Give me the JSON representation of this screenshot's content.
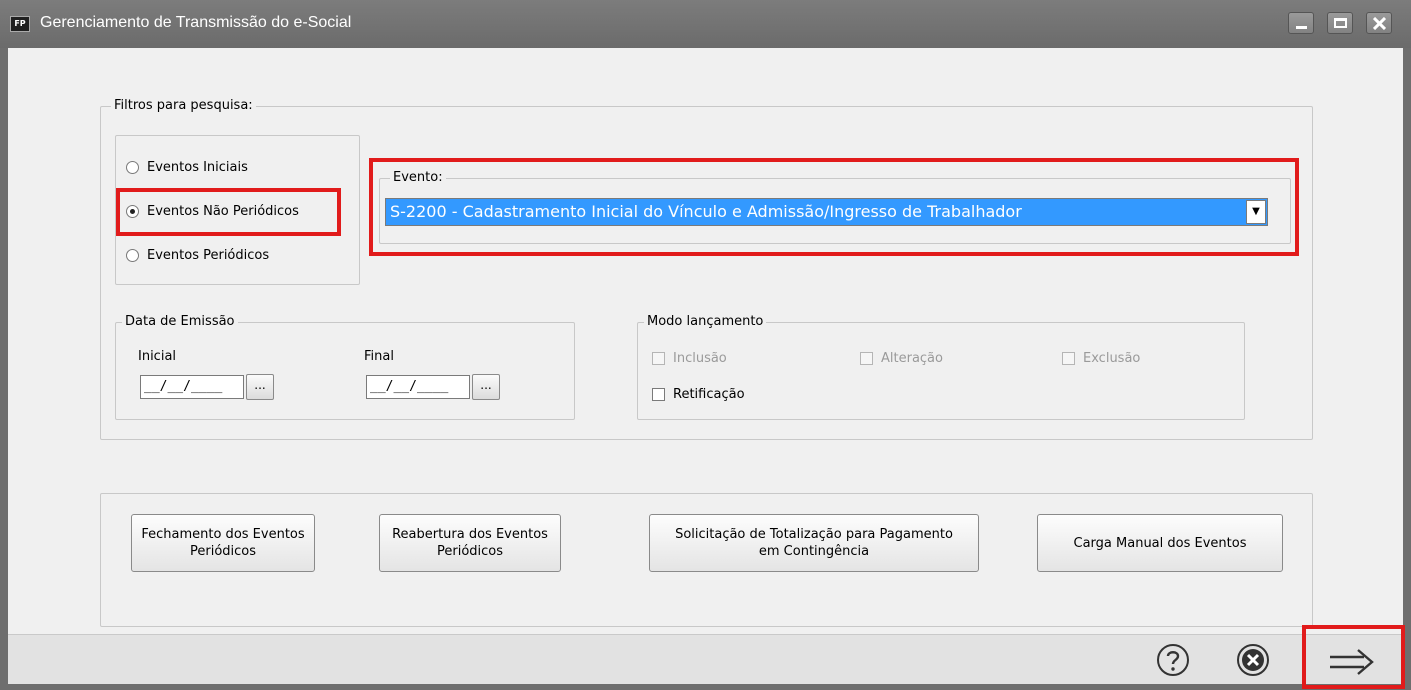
{
  "window": {
    "title": "Gerenciamento de Transmissão do e-Social",
    "app_icon": "FP",
    "controls": [
      "minimize-icon",
      "maximize-icon",
      "close-icon"
    ]
  },
  "filters": {
    "legend": "Filtros para pesquisa:",
    "radios": [
      {
        "label": "Eventos Iniciais",
        "checked": false
      },
      {
        "label": "Eventos Não Periódicos",
        "checked": true
      },
      {
        "label": "Eventos Periódicos",
        "checked": false
      }
    ],
    "evento": {
      "legend": "Evento:",
      "selected": "S-2200 - Cadastramento Inicial do Vínculo e Admissão/Ingresso de Trabalhador"
    }
  },
  "data_emissao": {
    "legend": "Data de Emissão",
    "inicial_label": "Inicial",
    "inicial_value": "__/__/____",
    "final_label": "Final",
    "final_value": "__/__/____",
    "picker_label": "..."
  },
  "modo_lancamento": {
    "legend": "Modo lançamento",
    "options": [
      {
        "label": "Inclusão",
        "checked": false,
        "enabled": false
      },
      {
        "label": "Alteração",
        "checked": false,
        "enabled": false
      },
      {
        "label": "Exclusão",
        "checked": false,
        "enabled": false
      },
      {
        "label": "Retificação",
        "checked": false,
        "enabled": true
      }
    ]
  },
  "actions": {
    "fechamento": "Fechamento dos Eventos\nPeriódicos",
    "reabertura": "Reabertura dos Eventos\nPeriódicos",
    "solicitacao": "Solicitação de Totalização para Pagamento\nem Contingência",
    "carga": "Carga Manual dos Eventos"
  },
  "footer": {
    "icons": [
      "help-icon",
      "cancel-icon",
      "next-arrow-icon"
    ]
  },
  "colors": {
    "highlight": "#e11b1b",
    "selection": "#3399ff",
    "titlebar": "#6e6e6e"
  }
}
